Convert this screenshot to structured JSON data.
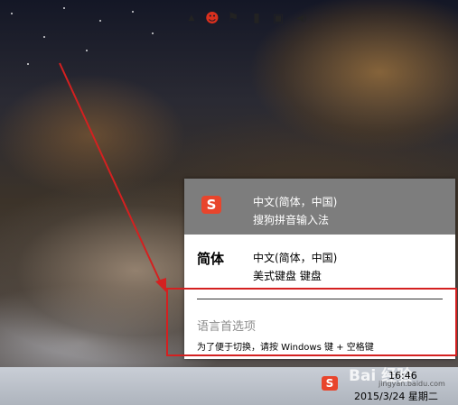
{
  "ime_popup": {
    "items": [
      {
        "icon": "sogou-icon",
        "icon_glyph": "S",
        "language": "中文(简体，中国)",
        "keyboard": "搜狗拼音输入法"
      },
      {
        "short_label": "简体",
        "language": "中文(简体，中国)",
        "keyboard": "美式键盘 键盘"
      }
    ],
    "preferences_link": "语言首选项",
    "switch_hint": "为了便于切换，请按 Windows 键 + 空格键"
  },
  "taskbar": {
    "tray_icons": [
      "show-hidden-icons-chevron",
      "qq-icon",
      "action-center-flag-icon",
      "battery-icon",
      "network-icon",
      "volume-icon",
      "sogou-ime-icon"
    ],
    "tray_glyphs": {
      "chevron": "▲",
      "qq": "☻",
      "flag": "⚑",
      "battery": "▮",
      "network": "▣",
      "volume": "◀)",
      "sogou": "S"
    },
    "time": "16:46",
    "date": "2015/3/24 星期二"
  },
  "watermark": {
    "text": "Bai 经验",
    "sub": "jingyan.baidu.com"
  },
  "colors": {
    "selected_row": "#7d7d7d",
    "annotation_red": "#d42020",
    "sogou_red": "#e8452c"
  }
}
